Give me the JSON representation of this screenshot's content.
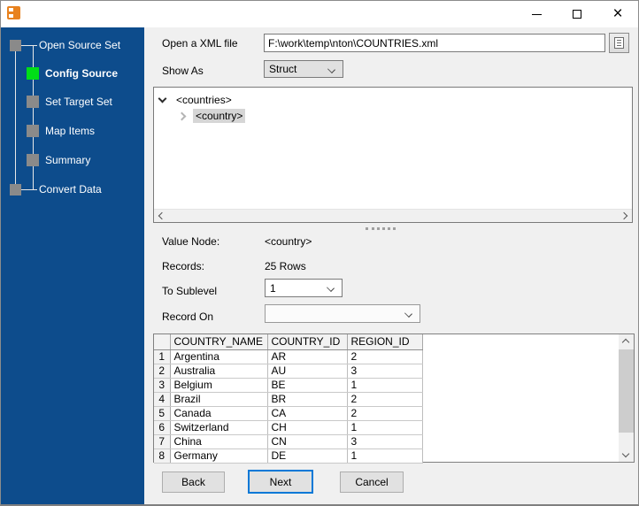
{
  "window": {
    "controls": {
      "minimize": "minimize",
      "maximize": "maximize",
      "close": "close"
    }
  },
  "colors": {
    "sidebar_background": "#0D4C8C",
    "active_step_green": "#00DE17",
    "inactive_step_gray": "#8A8A8A",
    "accent_blue": "#0078D7",
    "app_icon_orange": "#E8821E"
  },
  "sidebar": {
    "steps": [
      {
        "label": "Open Source Set",
        "level": 0,
        "active": false
      },
      {
        "label": "Config Source",
        "level": 1,
        "active": true
      },
      {
        "label": "Set Target Set",
        "level": 1,
        "active": false
      },
      {
        "label": "Map Items",
        "level": 1,
        "active": false
      },
      {
        "label": "Summary",
        "level": 1,
        "active": false
      },
      {
        "label": "Convert Data",
        "level": 0,
        "active": false
      }
    ]
  },
  "form": {
    "file_label": "Open a XML file",
    "file_value": "F:\\work\\temp\\nton\\COUNTRIES.xml",
    "show_as_label": "Show As",
    "show_as_value": "Struct",
    "value_node_label": "Value Node:",
    "value_node_value": "<country>",
    "records_label": "Records:",
    "records_value": "25 Rows",
    "to_sublevel_label": "To Sublevel",
    "to_sublevel_value": "1",
    "record_on_label": "Record On",
    "record_on_value": ""
  },
  "tree": {
    "nodes": [
      {
        "label": "<countries>",
        "expanded": true,
        "selected": false
      },
      {
        "label": "<country>",
        "expanded": false,
        "selected": true
      }
    ]
  },
  "table": {
    "columns": [
      "COUNTRY_NAME",
      "COUNTRY_ID",
      "REGION_ID"
    ],
    "rows": [
      {
        "num": "1",
        "cells": [
          "Argentina",
          "AR",
          "2"
        ]
      },
      {
        "num": "2",
        "cells": [
          "Australia",
          "AU",
          "3"
        ]
      },
      {
        "num": "3",
        "cells": [
          "Belgium",
          "BE",
          "1"
        ]
      },
      {
        "num": "4",
        "cells": [
          "Brazil",
          "BR",
          "2"
        ]
      },
      {
        "num": "5",
        "cells": [
          "Canada",
          "CA",
          "2"
        ]
      },
      {
        "num": "6",
        "cells": [
          "Switzerland",
          "CH",
          "1"
        ]
      },
      {
        "num": "7",
        "cells": [
          "China",
          "CN",
          "3"
        ]
      },
      {
        "num": "8",
        "cells": [
          "Germany",
          "DE",
          "1"
        ]
      }
    ]
  },
  "buttons": {
    "back": "Back",
    "next": "Next",
    "cancel": "Cancel"
  }
}
